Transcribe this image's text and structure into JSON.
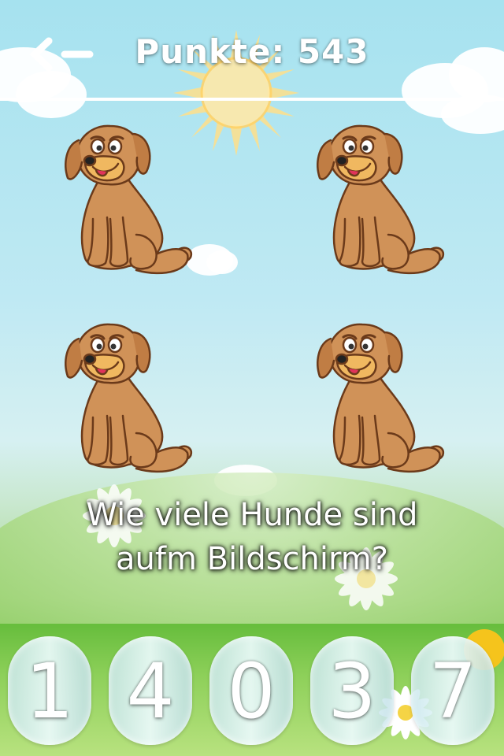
{
  "header": {
    "back_icon": "back-arrow-icon",
    "score_label": "Punkte: 543"
  },
  "scene": {
    "dog_icon": "dog-icon",
    "dog_count_shown": 4
  },
  "question": {
    "line1": "Wie viele Hunde sind",
    "line2": "aufm Bildschirm?"
  },
  "answers": [
    {
      "label": "1"
    },
    {
      "label": "4"
    },
    {
      "label": "0"
    },
    {
      "label": "3"
    },
    {
      "label": "7"
    }
  ],
  "colors": {
    "sky": "#a6e2ef",
    "grass": "#7cc35a",
    "dog_body": "#d09258",
    "dog_outline": "#6b3a1a"
  }
}
